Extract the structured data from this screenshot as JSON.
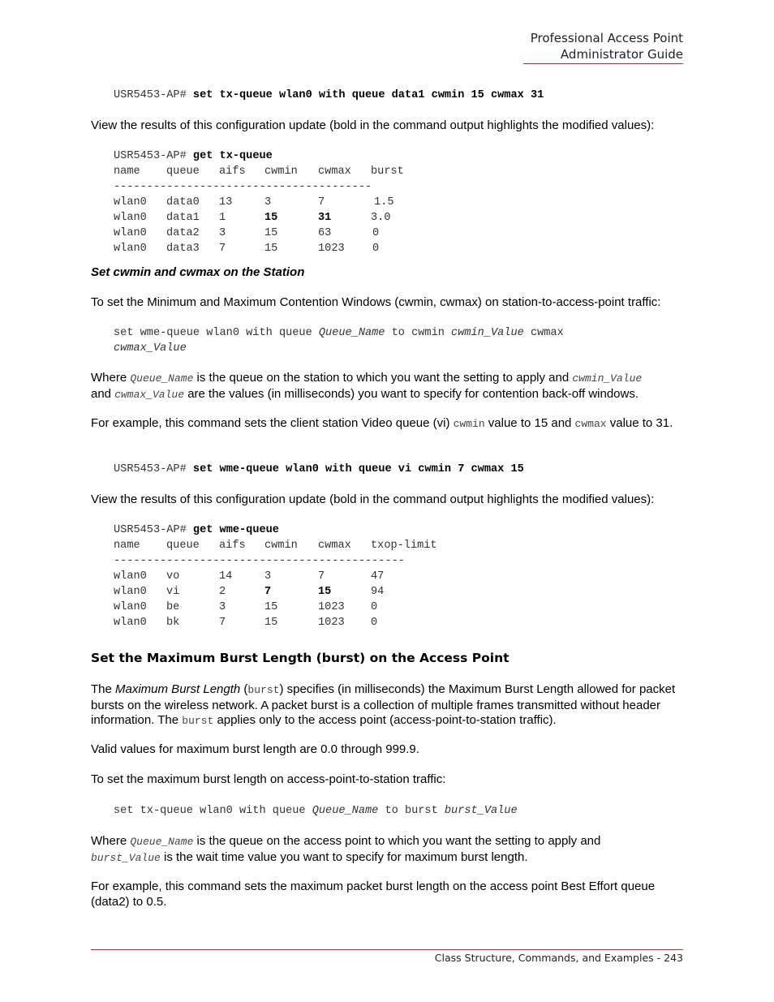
{
  "header": {
    "line1": "Professional Access Point",
    "line2": "Administrator Guide"
  },
  "footer": {
    "text": "Class Structure, Commands, and Examples - 243"
  },
  "cmd1": {
    "prompt": "USR5453-AP#",
    "command": "set tx-queue wlan0 with queue data1 cwmin 15 cwmax 31"
  },
  "para_view1": "View the results of this configuration update (bold in the command output highlights the modified values):",
  "tx_output": {
    "prompt": "USR5453-AP#",
    "command": "get tx-queue",
    "columns": [
      "name",
      "queue",
      "aifs",
      "cwmin",
      "cwmax",
      "burst"
    ],
    "separator": "---------------------------------------",
    "rows": [
      [
        "wlan0",
        "data0",
        "13",
        "3",
        "7",
        "1.5"
      ],
      [
        "wlan0",
        "data1",
        "1",
        "15",
        "31",
        "3.0"
      ],
      [
        "wlan0",
        "data2",
        "3",
        "15",
        "63",
        "0"
      ],
      [
        "wlan0",
        "data3",
        "7",
        "15",
        "1023",
        "0"
      ]
    ],
    "bold_cells": [
      [
        1,
        3
      ],
      [
        1,
        4
      ]
    ]
  },
  "section_station": {
    "heading": "Set cwmin and cwmax on the Station",
    "intro": "To set the Minimum and Maximum Contention Windows (cwmin, cwmax) on station-to-access-point traffic:",
    "syntax": {
      "part1": "set wme-queue wlan0 with queue ",
      "var1": "Queue_Name",
      "part2": " to cwmin ",
      "var2": "cwmin_Value",
      "part3": " cwmax",
      "var3": "cwmax_Value"
    },
    "where": {
      "t1": "Where ",
      "v1": "Queue_Name",
      "t2": " is the queue on the station to which you want the setting to apply and ",
      "v2": "cwmin_Value",
      "t3": "and ",
      "v3": "cwmax_Value",
      "t4": " are the values (in milliseconds) you want to specify for contention back-off windows."
    },
    "example": {
      "t1": "For example, this command sets the client station Video queue (vi) ",
      "c1": "cwmin",
      "t2": " value to 15 and ",
      "c2": "cwmax",
      "t3": " value to 31."
    },
    "cmd": {
      "prompt": "USR5453-AP#",
      "command": "set wme-queue wlan0 with queue vi cwmin 7 cwmax 15"
    },
    "para_view2": "View the results of this configuration update (bold in the command output highlights the modified values):"
  },
  "wme_output": {
    "prompt": "USR5453-AP#",
    "command": "get wme-queue",
    "columns": [
      "name",
      "queue",
      "aifs",
      "cwmin",
      "cwmax",
      "txop-limit"
    ],
    "separator": "--------------------------------------------",
    "rows": [
      [
        "wlan0",
        "vo",
        "14",
        "3",
        "7",
        "47"
      ],
      [
        "wlan0",
        "vi",
        "2",
        "7",
        "15",
        "94"
      ],
      [
        "wlan0",
        "be",
        "3",
        "15",
        "1023",
        "0"
      ],
      [
        "wlan0",
        "bk",
        "7",
        "15",
        "1023",
        "0"
      ]
    ],
    "bold_cells": [
      [
        1,
        3
      ],
      [
        1,
        4
      ]
    ]
  },
  "section_burst": {
    "heading": "Set the Maximum Burst Length (burst) on the Access Point",
    "desc": {
      "t1": "The ",
      "em": "Maximum Burst Length",
      "t2": " (",
      "c1": "burst",
      "t3": ") specifies (in milliseconds) the Maximum Burst Length allowed for packet bursts on the wireless network. A packet burst is a collection of multiple frames transmitted without header information. The ",
      "c2": "burst",
      "t4": " applies only to the access point (access-point-to-station traffic)."
    },
    "valid": "Valid values for maximum burst length are 0.0 through 999.9.",
    "intro": "To set the maximum burst length on access-point-to-station traffic:",
    "syntax": {
      "part1": "set tx-queue wlan0 with queue ",
      "var1": "Queue_Name",
      "part2": " to burst ",
      "var2": "burst_Value"
    },
    "where": {
      "t1": "Where ",
      "v1": "Queue_Name",
      "t2": " is the queue on the access point to which you want the setting to apply and",
      "v2": "burst_Value",
      "t3": " is the wait time value you want to specify for maximum burst length."
    },
    "example": "For example, this command sets the maximum packet burst length on the access point Best Effort queue (data2) to 0.5."
  },
  "colors": {
    "rule": "#d42020",
    "text": "#000000",
    "mono_text": "#333333"
  }
}
